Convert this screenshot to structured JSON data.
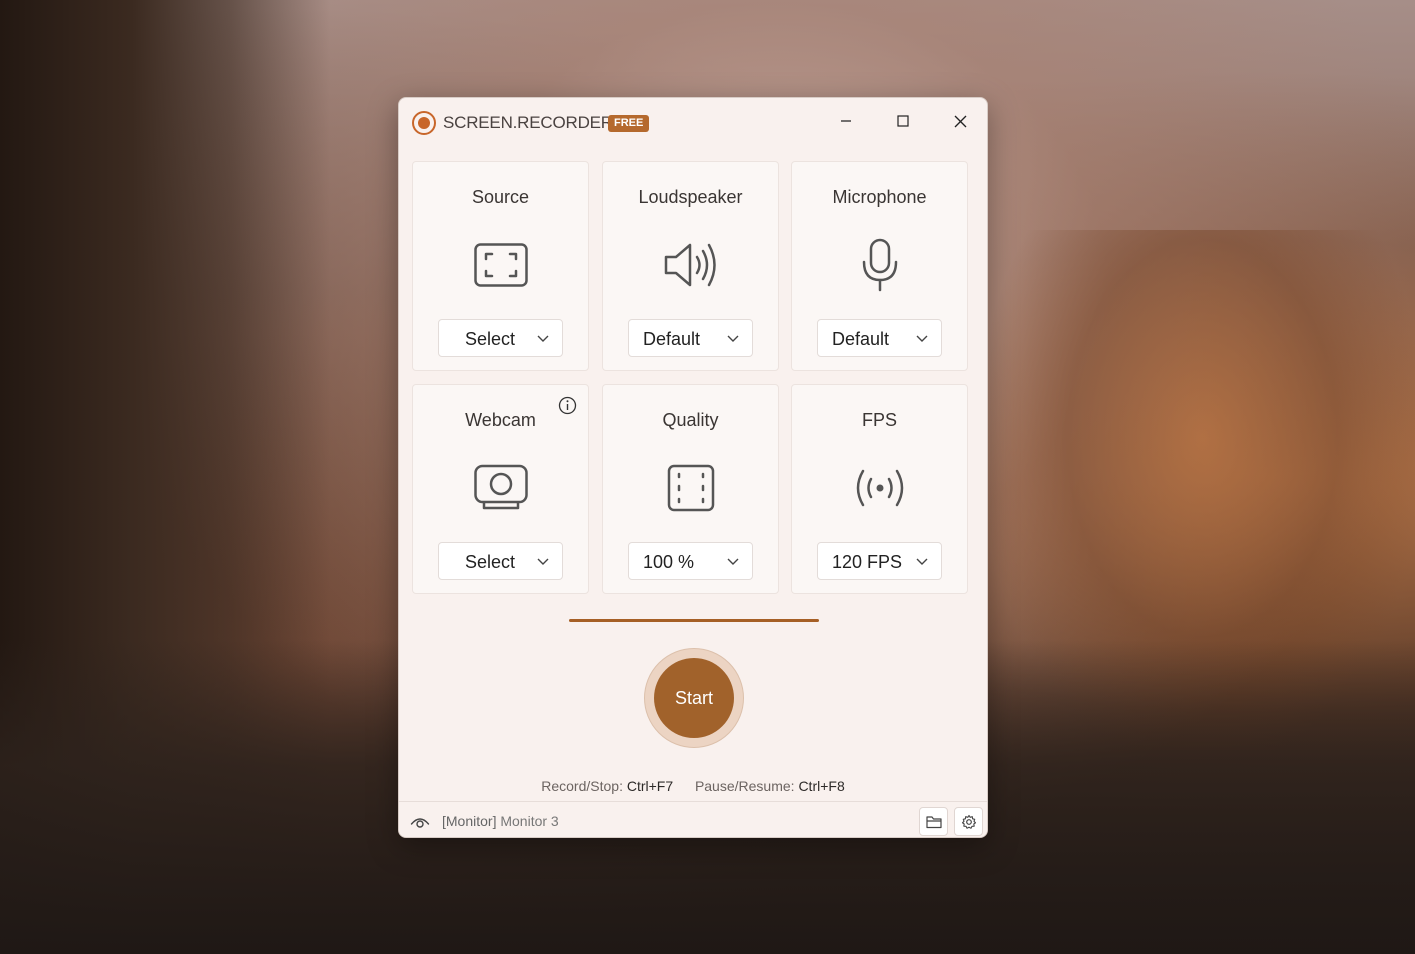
{
  "app": {
    "title": "SCREEN.RECORDER",
    "badge": "FREE"
  },
  "cards": {
    "source": {
      "title": "Source",
      "value": "Select"
    },
    "loudspeaker": {
      "title": "Loudspeaker",
      "value": "Default"
    },
    "microphone": {
      "title": "Microphone",
      "value": "Default"
    },
    "webcam": {
      "title": "Webcam",
      "value": "Select"
    },
    "quality": {
      "title": "Quality",
      "value": "100 %"
    },
    "fps": {
      "title": "FPS",
      "value": "120 FPS"
    }
  },
  "start": {
    "label": "Start"
  },
  "hotkeys": {
    "record_label": "Record/Stop:",
    "record_key": "Ctrl+F7",
    "pause_label": "Pause/Resume:",
    "pause_key": "Ctrl+F8"
  },
  "status": {
    "tag": "[Monitor]",
    "value": "Monitor 3"
  },
  "colors": {
    "accent": "#a1622b",
    "window_bg": "#f9f1ee",
    "badge": "#b5692d"
  }
}
